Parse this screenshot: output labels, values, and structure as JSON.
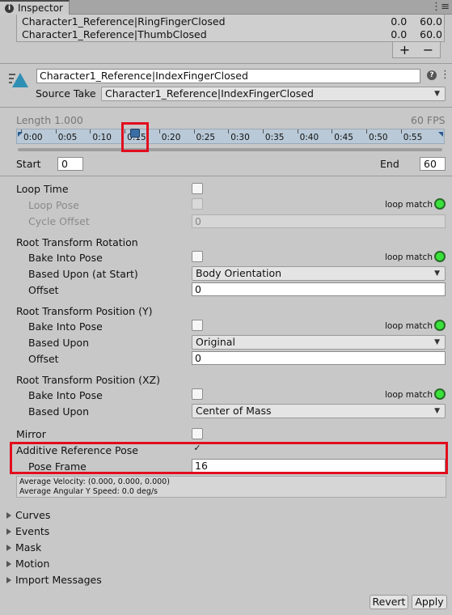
{
  "tab": {
    "title": "Inspector"
  },
  "clip_list": [
    {
      "name": "Character1_Reference|RingFingerClosed",
      "start": "0.0",
      "end": "60.0"
    },
    {
      "name": "Character1_Reference|ThumbClosed",
      "start": "0.0",
      "end": "60.0"
    }
  ],
  "clip_list_buttons": {
    "add": "+",
    "remove": "−"
  },
  "header": {
    "clip_name": "Character1_Reference|IndexFingerClosed",
    "source_take_label": "Source Take",
    "source_take_value": "Character1_Reference|IndexFingerClosed"
  },
  "timeline": {
    "length_label": "Length  1.000",
    "fps_label": "60 FPS",
    "ticks": [
      "0:00",
      "0:05",
      "0:10",
      "0:15",
      "0:20",
      "0:25",
      "0:30",
      "0:35",
      "0:40",
      "0:45",
      "0:50",
      "0:55"
    ],
    "playhead_fraction": 0.267
  },
  "range": {
    "start_label": "Start",
    "start_value": "0",
    "end_label": "End",
    "end_value": "60"
  },
  "loop_time": {
    "label": "Loop Time",
    "loop_pose_label": "Loop Pose",
    "loop_match_label": "loop match",
    "cycle_offset_label": "Cycle Offset",
    "cycle_offset_value": "0"
  },
  "root_rotation": {
    "title": "Root Transform Rotation",
    "bake_label": "Bake Into Pose",
    "loop_match_label": "loop match",
    "based_upon_label": "Based Upon (at Start)",
    "based_upon_value": "Body Orientation",
    "offset_label": "Offset",
    "offset_value": "0"
  },
  "root_position_y": {
    "title": "Root Transform Position (Y)",
    "bake_label": "Bake Into Pose",
    "loop_match_label": "loop match",
    "based_upon_label": "Based Upon",
    "based_upon_value": "Original",
    "offset_label": "Offset",
    "offset_value": "0"
  },
  "root_position_xz": {
    "title": "Root Transform Position (XZ)",
    "bake_label": "Bake Into Pose",
    "loop_match_label": "loop match",
    "based_upon_label": "Based Upon",
    "based_upon_value": "Center of Mass"
  },
  "mirror": {
    "label": "Mirror"
  },
  "additive": {
    "label": "Additive Reference Pose",
    "checkmark": "✓",
    "pose_frame_label": "Pose Frame",
    "pose_frame_value": "16"
  },
  "info": {
    "velocity": "Average Velocity: (0.000, 0.000, 0.000)",
    "angular": "Average Angular Y Speed: 0.0 deg/s"
  },
  "foldouts": [
    "Curves",
    "Events",
    "Mask",
    "Motion",
    "Import Messages"
  ],
  "buttons": {
    "revert": "Revert",
    "apply": "Apply"
  },
  "colors": {
    "loop_match_ok": "#39e239",
    "highlight_red": "#e10d1d",
    "ruler_blue": "#b9c9d7"
  }
}
